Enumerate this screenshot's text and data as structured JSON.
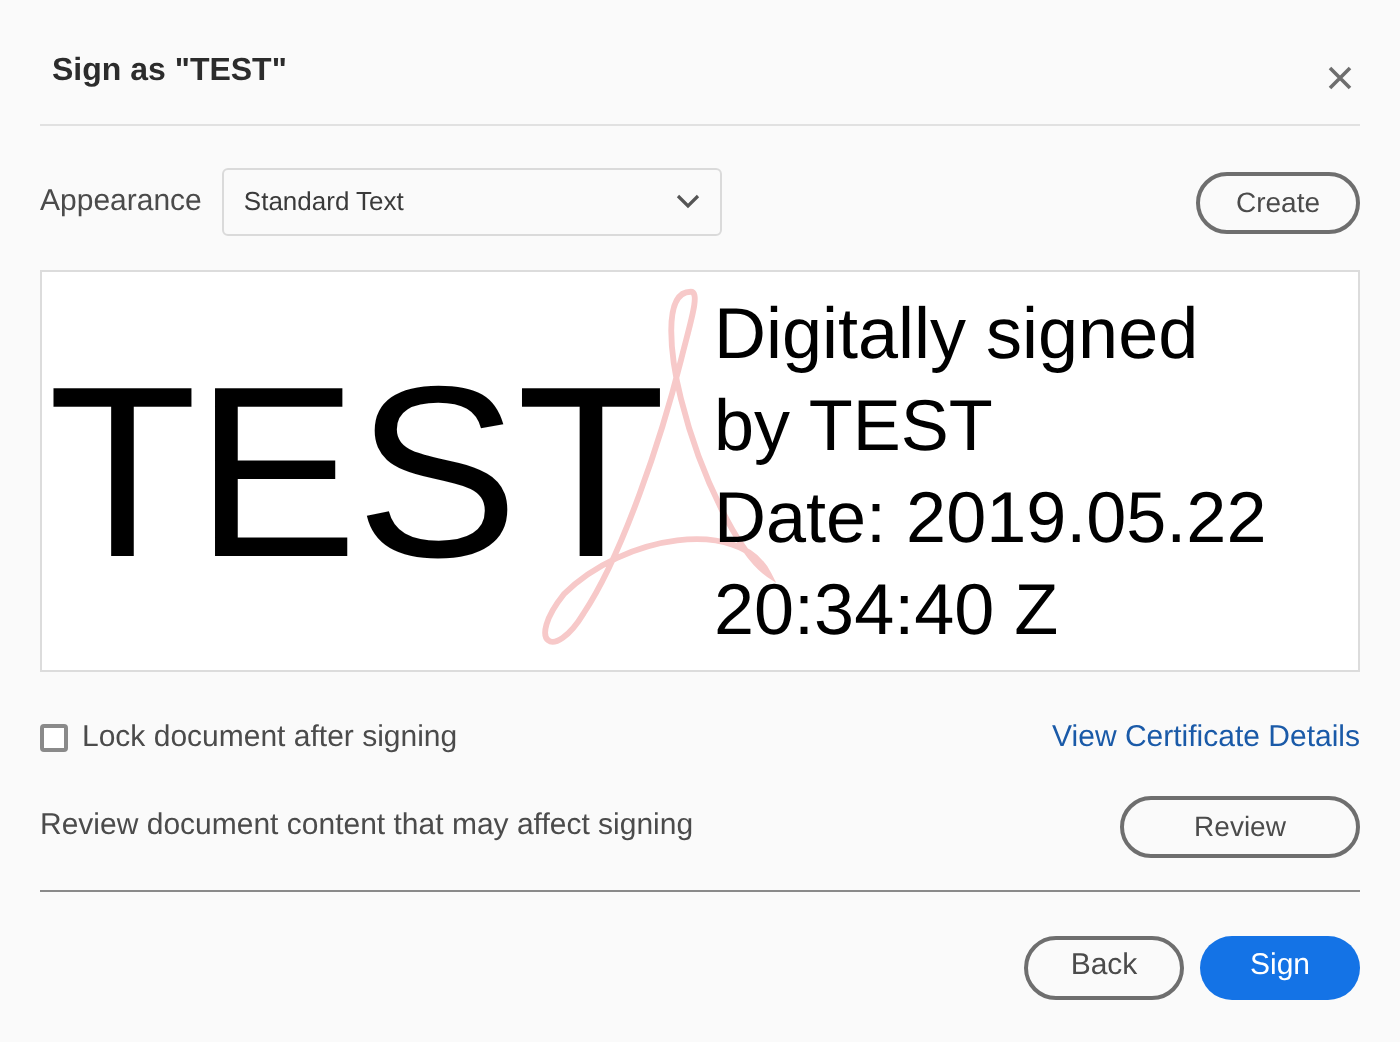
{
  "dialog": {
    "title": "Sign as \"TEST\""
  },
  "appearance": {
    "label": "Appearance",
    "value": "Standard Text",
    "create_button": "Create"
  },
  "preview": {
    "name": "TEST",
    "details": [
      "Digitally signed",
      "by TEST",
      "Date: 2019.05.22",
      "20:34:40 Z"
    ]
  },
  "lock": {
    "label": "Lock document after signing",
    "checked": false
  },
  "certificate_link": "View Certificate Details",
  "review": {
    "text": "Review document content that may affect signing",
    "button": "Review"
  },
  "footer_buttons": [
    {
      "label": "Back",
      "kind": "secondary"
    },
    {
      "label": "Sign",
      "kind": "primary"
    }
  ]
}
